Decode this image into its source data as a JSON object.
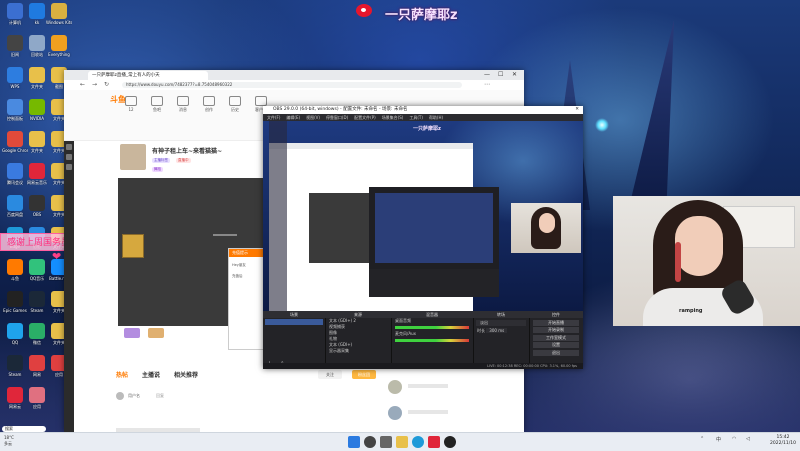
{
  "overlay": {
    "streamer_name": "一只萨摩耶z",
    "banner": "感谢上周国务员：贝德",
    "heart": "❤"
  },
  "desktop_icons": [
    {
      "label": "计算机",
      "color": "#3b6fd1"
    },
    {
      "label": "kk",
      "color": "#1f7ae0"
    },
    {
      "label": "Windows Kits",
      "color": "#d9b040"
    },
    {
      "label": "旧闻",
      "color": "#444"
    },
    {
      "label": "回收站",
      "color": "#8fa8c8"
    },
    {
      "label": "Everything",
      "color": "#f0a020"
    },
    {
      "label": "WPS",
      "color": "#2d7de0"
    },
    {
      "label": "文件夹",
      "color": "#e8c04a"
    },
    {
      "label": "截图",
      "color": "#e8c04a"
    },
    {
      "label": "控制面板",
      "color": "#4a8ae0"
    },
    {
      "label": "NVIDIA",
      "color": "#76b900"
    },
    {
      "label": "文件夹",
      "color": "#e8c04a"
    },
    {
      "label": "Google Chrome",
      "color": "#e24a3a"
    },
    {
      "label": "文件夹",
      "color": "#e8c04a"
    },
    {
      "label": "文件夹",
      "color": "#e8c04a"
    },
    {
      "label": "腾讯会议",
      "color": "#3a7ae0"
    },
    {
      "label": "网易云音乐",
      "color": "#e0263a"
    },
    {
      "label": "文件夹",
      "color": "#e8c04a"
    },
    {
      "label": "百度网盘",
      "color": "#2a8ae0"
    },
    {
      "label": "OBS",
      "color": "#333"
    },
    {
      "label": "文件夹",
      "color": "#e8c04a"
    },
    {
      "label": "Edge",
      "color": "#1e9ad8"
    },
    {
      "label": "钉钉",
      "color": "#2a8ae0"
    },
    {
      "label": "文件夹",
      "color": "#e8c04a"
    },
    {
      "label": "斗鱼",
      "color": "#ff7a00"
    },
    {
      "label": "QQ音乐",
      "color": "#31c27c"
    },
    {
      "label": "Battle.net",
      "color": "#148eff"
    },
    {
      "label": "Epic Games",
      "color": "#222"
    },
    {
      "label": "Steam",
      "color": "#1b2838"
    },
    {
      "label": "文件夹",
      "color": "#e8c04a"
    },
    {
      "label": "QQ",
      "color": "#1fa3ec"
    },
    {
      "label": "微信",
      "color": "#2aae67"
    },
    {
      "label": "文件夹",
      "color": "#e8c04a"
    },
    {
      "label": "Steam",
      "color": "#1b2838"
    },
    {
      "label": "网易",
      "color": "#e04040"
    },
    {
      "label": "应用",
      "color": "#e04040"
    },
    {
      "label": "网易云",
      "color": "#e0263a"
    },
    {
      "label": "应用",
      "color": "#e07080"
    }
  ],
  "browser": {
    "tab_title": "一只萨摩耶z直播_常上有人的小天",
    "url": "https://www.douyu.com/7482377?=8.754048960322",
    "logo": "斗鱼",
    "nav_items": [
      "12",
      "鱼吧",
      "消息",
      "创作",
      "历史",
      "客户端"
    ],
    "room_title": "有神子租上车~来看猫猫~",
    "tags": [
      "主播标签",
      "直播中",
      "舞蹈"
    ],
    "dialog_title": "充值提示",
    "dialog_lines": [
      "Hey朋友",
      "充值后"
    ],
    "bottom_tabs": [
      "热帖",
      "主播说",
      "相关推荐"
    ],
    "side_buttons": [
      "关注",
      "粉丝团"
    ],
    "comment_user": "用户名",
    "comment_meta": "回复"
  },
  "obs": {
    "title": "OBS 29.0.0 (64-bit, windows) - 配置文件: 未命名 - 场景: 未命名",
    "menu": [
      "文件(F)",
      "编辑(E)",
      "视图(V)",
      "停靠窗口(D)",
      "配置文件(P)",
      "场景集合(S)",
      "工具(T)",
      "帮助(H)"
    ],
    "preview_text": "一只萨摩耶z",
    "docks": {
      "scenes_header": "场景",
      "sources_header": "来源",
      "mixer_header": "混音器",
      "transitions_header": "转场",
      "controls_header": "控件",
      "sources": [
        "文本 (GDI+) 2",
        "视频捕获",
        "图像",
        "礼物",
        "文本 (GDI+)",
        "显示器采集"
      ],
      "mixer": [
        "桌面音频",
        "麦克风/Aux"
      ],
      "transition_type": "淡出",
      "duration_label": "时长",
      "duration_value": "300 ms",
      "controls": [
        "开始直播",
        "开始录制",
        "工作室模式",
        "设置",
        "退出"
      ]
    },
    "status": "LIVE: 00:12:38  REC: 00:00:00  CPU: 3.1%, 60.00 fps"
  },
  "camera": {
    "shirt_text": "ramping"
  },
  "taskbar": {
    "weather_temp": "18°C",
    "weather_desc": "多云",
    "time": "15:42",
    "date": "2022/11/10",
    "search_placeholder": "搜索",
    "tray_lang": "中"
  }
}
